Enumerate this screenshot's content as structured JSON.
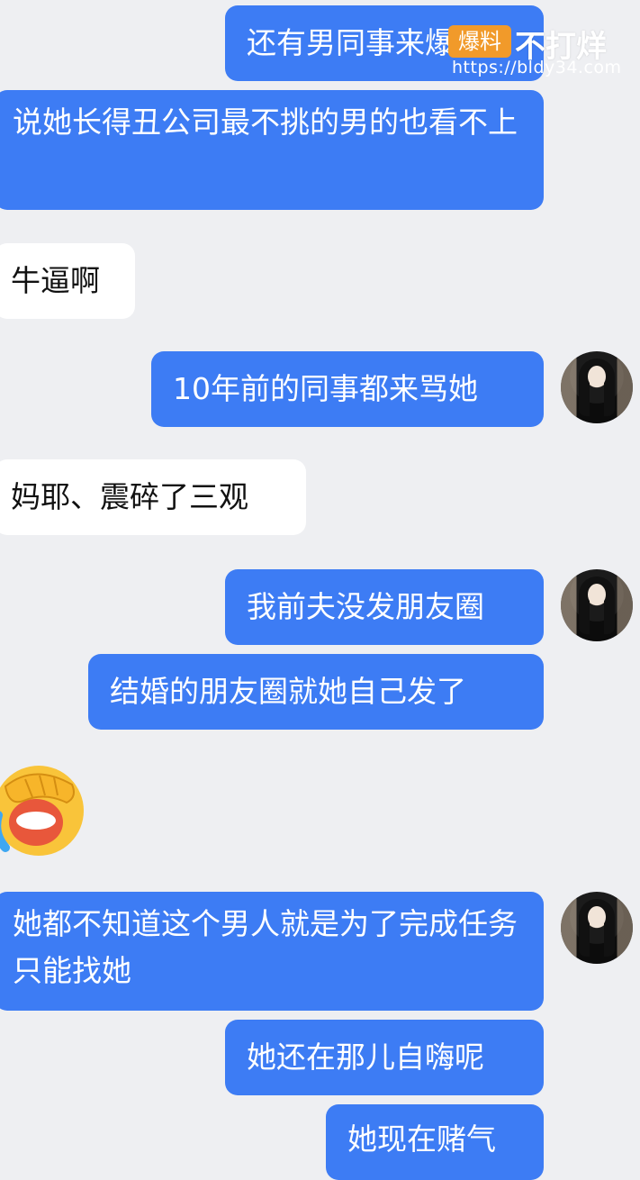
{
  "messages": [
    {
      "text": "还有男同事来爆料"
    },
    {
      "text": "说她长得丑公司最不挑的男的也看不上"
    },
    {
      "text": "牛逼啊"
    },
    {
      "text": "10年前的同事都来骂她"
    },
    {
      "text": "妈耶、震碎了三观"
    },
    {
      "text": "我前夫没发朋友圈"
    },
    {
      "text": "结婚的朋友圈就她自己发了"
    },
    {
      "text": "她都不知道这个男人就是为了完成任务只能找她"
    },
    {
      "text": "她还在那儿自嗨呢"
    },
    {
      "text": "她现在赌气"
    }
  ],
  "watermark": {
    "badge": "爆料",
    "title": "不打烊",
    "url": "https://bldy34.com"
  },
  "emoji": {
    "name": "facepalm-laughing-emoji"
  },
  "colors": {
    "outgoing": "#3d7cf4",
    "incoming": "#ffffff",
    "background": "#eeeff2"
  }
}
